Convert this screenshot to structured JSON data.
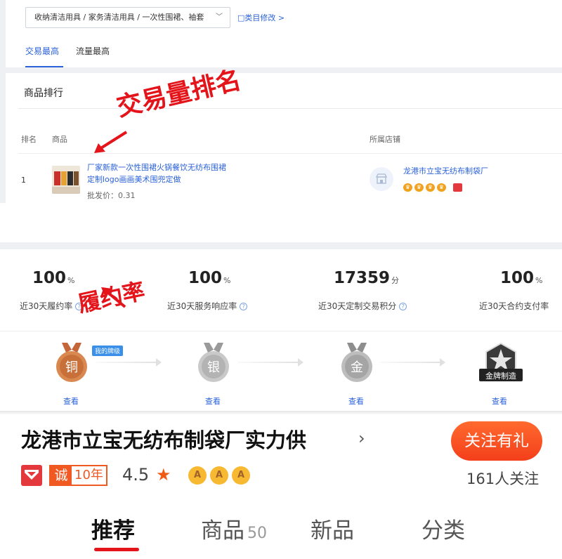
{
  "panel1": {
    "category_path": "收纳清洁用具 / 家务清洁用具 / 一次性围裙、袖套",
    "category_edit": "□类目修改 >",
    "tabs": [
      {
        "label": "交易最高",
        "active": true
      },
      {
        "label": "流量最高",
        "active": false
      }
    ],
    "section_title": "商品排行",
    "table": {
      "headers": {
        "rank": "排名",
        "product": "商品",
        "shop": "所属店铺"
      },
      "rows": [
        {
          "rank": "1",
          "name": "厂家新款一次性围裙火锅餐饮无纺布围裙定制logo画画美术围兜定做",
          "price": "批发价：0.31",
          "shop": "龙港市立宝无纺布制袋厂"
        }
      ]
    }
  },
  "annotations": {
    "trade_volume": "交易量排名",
    "fulfillment": "履约率"
  },
  "panel2": {
    "stats": [
      {
        "value": "100",
        "unit": "%",
        "label": "近30天履约率"
      },
      {
        "value": "100",
        "unit": "%",
        "label": "近30天服务响应率"
      },
      {
        "value": "17359",
        "unit": "分",
        "label": "近30天定制交易积分"
      },
      {
        "value": "100",
        "unit": "%",
        "label": "近30天合约支付率"
      }
    ],
    "my_level_tag": "我的牌级",
    "medals": [
      {
        "char": "铜",
        "link": "查看",
        "color": "#d27a3c"
      },
      {
        "char": "银",
        "link": "查看",
        "color": "#b4b4b4"
      },
      {
        "char": "金",
        "link": "查看",
        "color": "#a8a8a8"
      },
      {
        "char": "金牌制造",
        "link": "查看",
        "color": "#2c2c2c"
      }
    ]
  },
  "panel3": {
    "shop_title": "龙港市立宝无纺布制袋厂实力供",
    "follow_button": "关注有礼",
    "follow_count": "161人关注",
    "cheng": "诚",
    "years": "10年",
    "rating": "4.5",
    "aaa": [
      "A",
      "A",
      "A"
    ],
    "nav_tabs": [
      {
        "label": "推荐",
        "count": "",
        "active": true
      },
      {
        "label": "商品",
        "count": "50",
        "active": false
      },
      {
        "label": "新品",
        "count": "",
        "active": false
      },
      {
        "label": "分类",
        "count": "",
        "active": false
      }
    ]
  }
}
